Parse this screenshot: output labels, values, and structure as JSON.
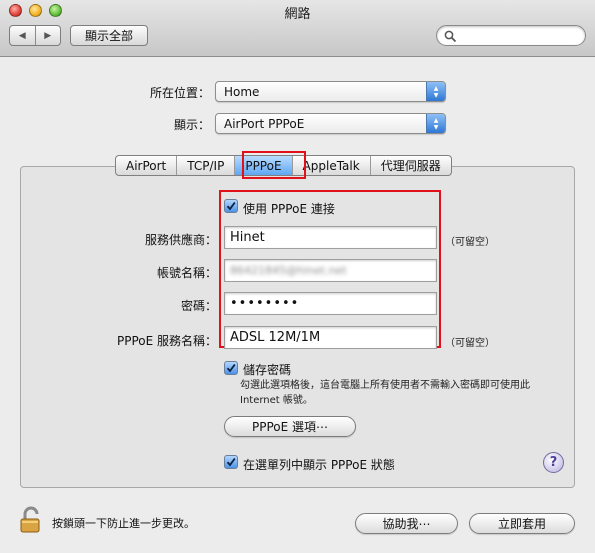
{
  "window": {
    "title": "網路"
  },
  "toolbar": {
    "back_glyph": "◀",
    "forward_glyph": "▶",
    "show_all_label": "顯示全部",
    "search_placeholder": ""
  },
  "location": {
    "label": "所在位置：",
    "value": "Home"
  },
  "show": {
    "label": "顯示：",
    "value": "AirPort PPPoE"
  },
  "tabs": [
    {
      "label": "AirPort",
      "selected": false
    },
    {
      "label": "TCP/IP",
      "selected": false
    },
    {
      "label": "PPPoE",
      "selected": true
    },
    {
      "label": "AppleTalk",
      "selected": false
    },
    {
      "label": "代理伺服器",
      "selected": false
    }
  ],
  "pppoe": {
    "use_pppoe": {
      "label": "使用 PPPoE 連接",
      "checked": true
    },
    "provider": {
      "label": "服務供應商：",
      "value": "Hinet",
      "hint": "（可留空）"
    },
    "account": {
      "label": "帳號名稱：",
      "value": "86421845@hinet.net"
    },
    "password": {
      "label": "密碼：",
      "value": "••••••••"
    },
    "service": {
      "label": "PPPoE 服務名稱：",
      "value": "ADSL 12M/1M",
      "hint": "（可留空）"
    },
    "save_password": {
      "label": "儲存密碼",
      "checked": true,
      "note": "勾選此選項格後，這台電腦上所有使用者不需輸入密碼即可使用此 Internet 帳號。"
    },
    "options_button": "PPPoE 選項⋯",
    "show_in_menubar": {
      "label": "在選單列中顯示 PPPoE 狀態",
      "checked": true
    }
  },
  "footer": {
    "lock_text": "按鎖頭一下防止進一步更改。",
    "assist_button": "協助我⋯",
    "apply_button": "立即套用",
    "help_glyph": "?"
  },
  "colors": {
    "highlight_border": "#e0111b",
    "accent": "#4d92e6"
  }
}
